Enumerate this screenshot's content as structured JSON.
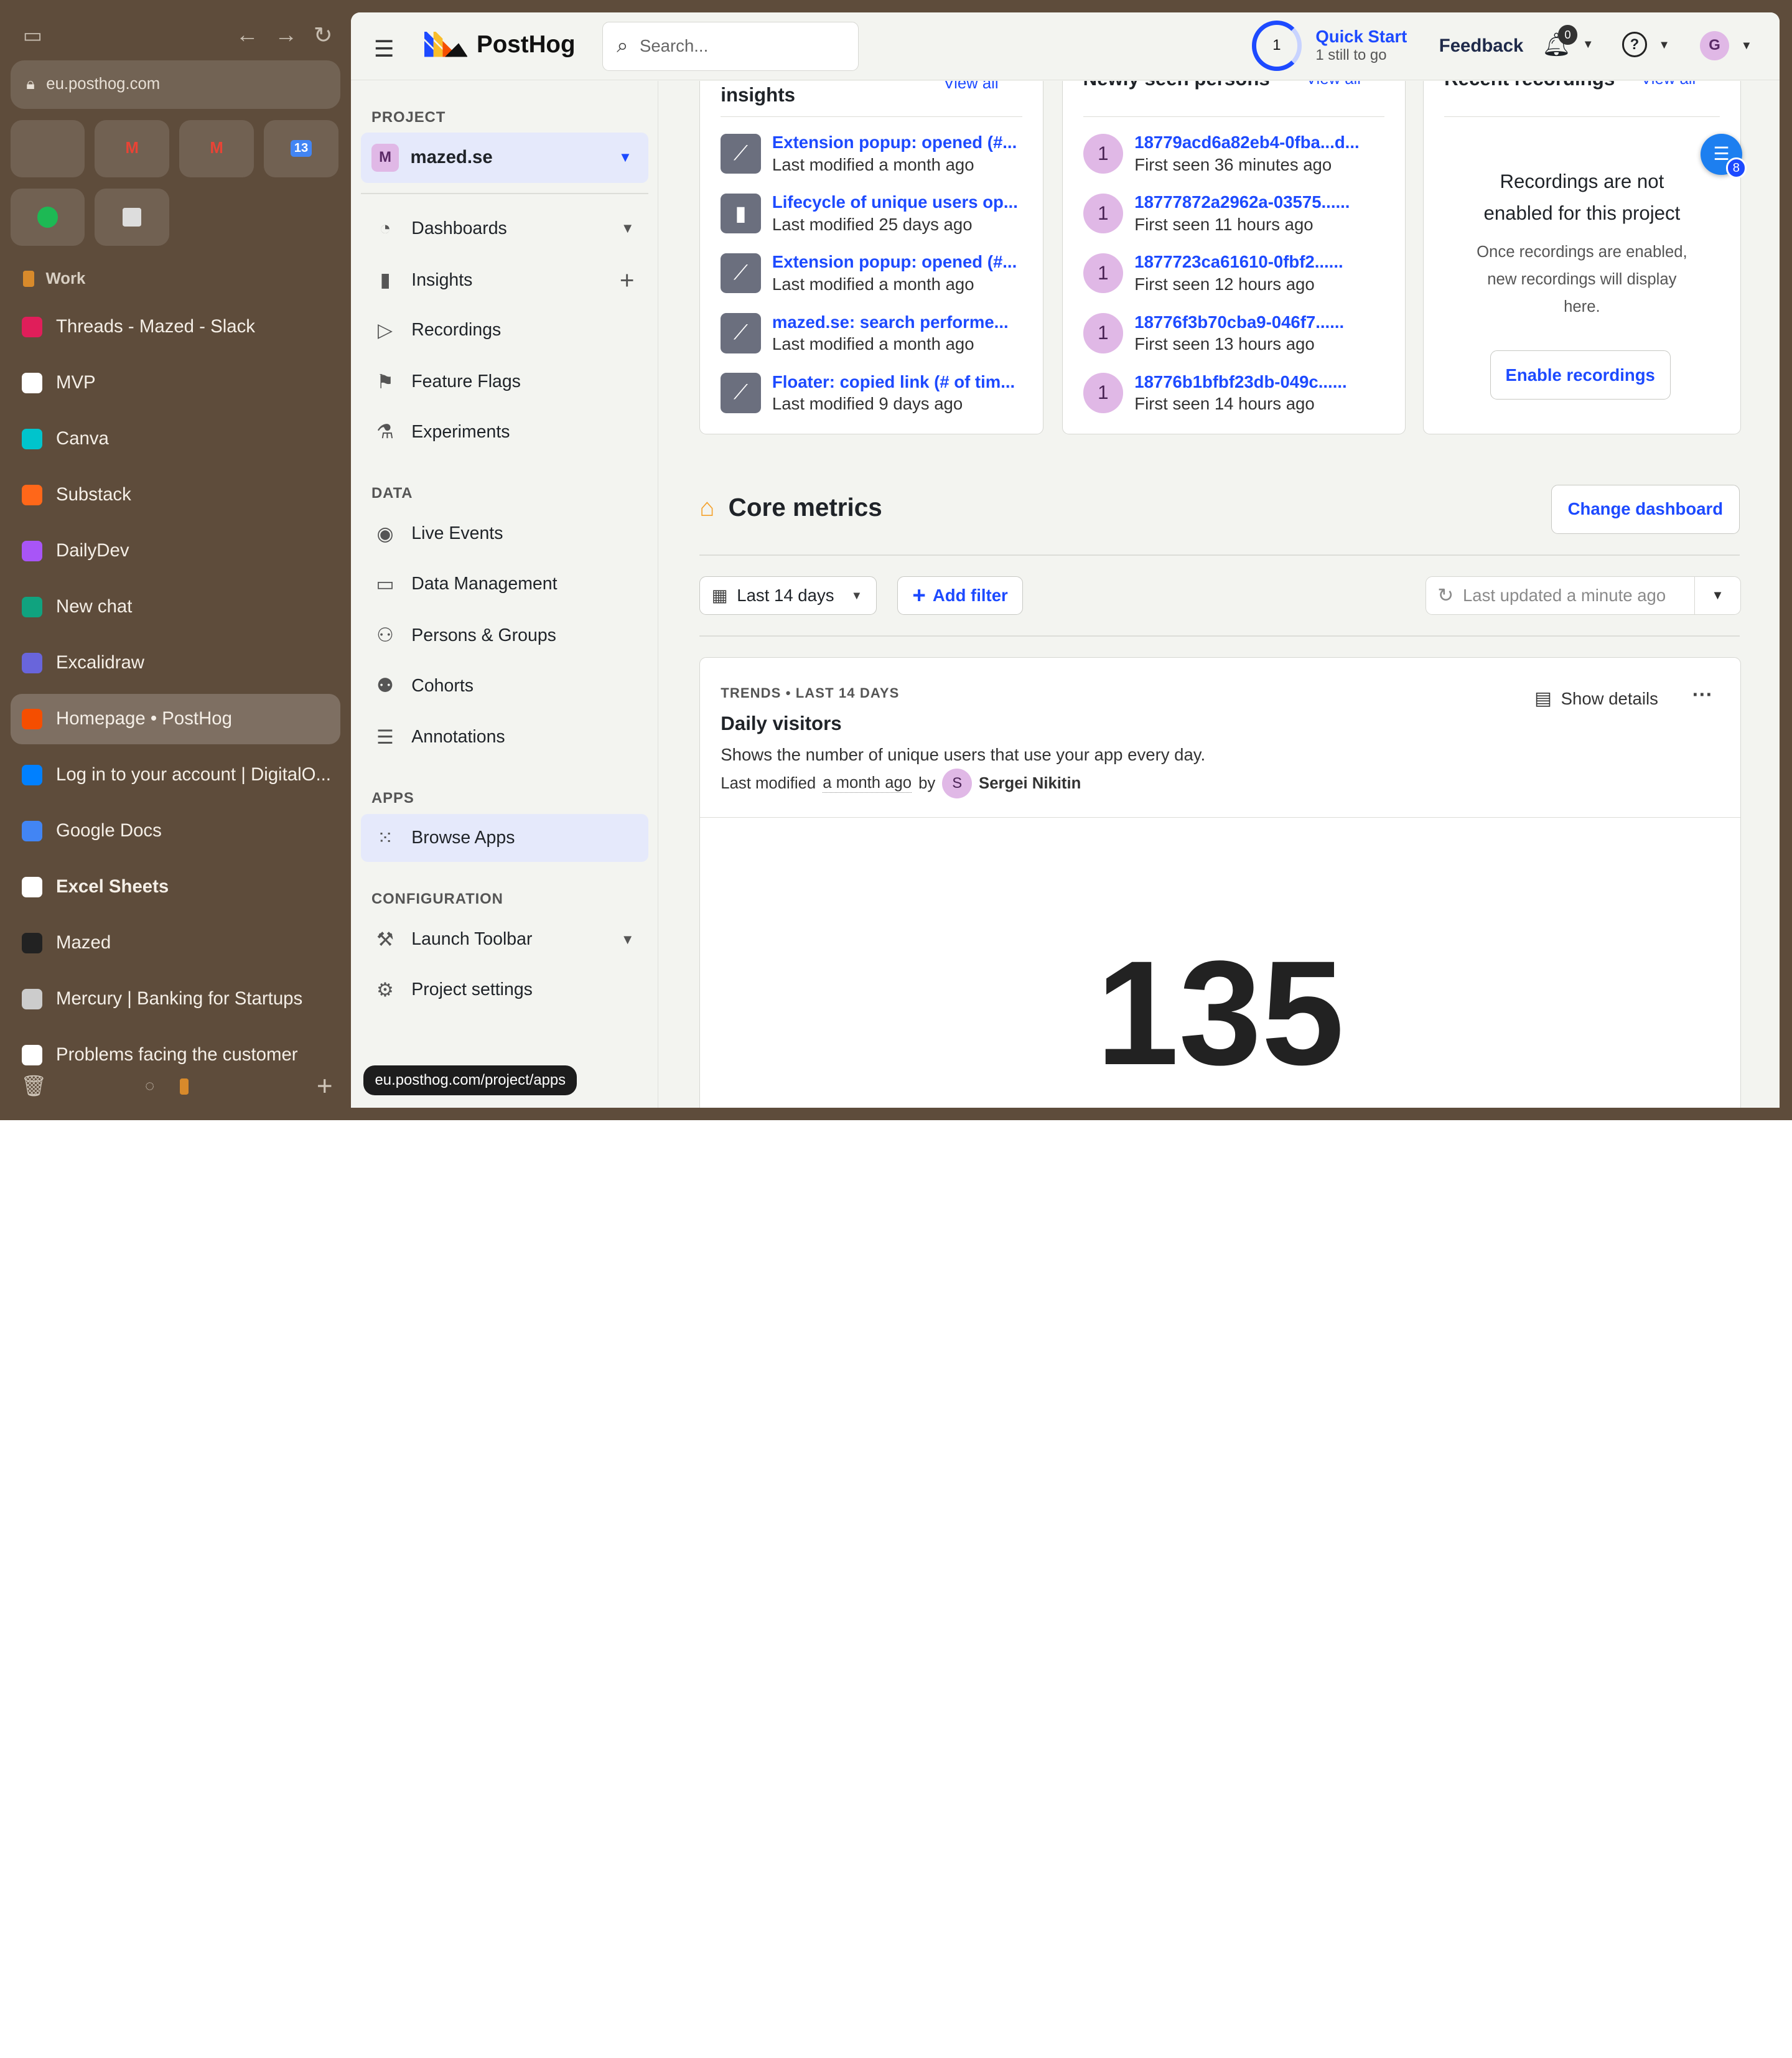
{
  "browser": {
    "url": "eu.posthog.com",
    "space_name": "Work",
    "tabs": [
      {
        "label": "Threads - Mazed - Slack",
        "icon": "slack-icon",
        "color": "#e01e5a"
      },
      {
        "label": "MVP",
        "icon": "github-icon",
        "color": "#ffffff"
      },
      {
        "label": "Canva",
        "icon": "canva-icon",
        "color": "#00c4cc"
      },
      {
        "label": "Substack",
        "icon": "substack-icon",
        "color": "#ff6719"
      },
      {
        "label": "DailyDev",
        "icon": "dailydev-icon",
        "color": "#a855f7"
      },
      {
        "label": "New chat",
        "icon": "openai-icon",
        "color": "#10a37f"
      },
      {
        "label": "Excalidraw",
        "icon": "excalidraw-icon",
        "color": "#6965db"
      },
      {
        "label": "Homepage • PostHog",
        "icon": "posthog-icon",
        "color": "#f54e00"
      },
      {
        "label": "Log in to your account | DigitalO...",
        "icon": "digitalocean-icon",
        "color": "#0080ff"
      },
      {
        "label": "Google Docs",
        "icon": "google-docs-icon",
        "color": "#4285f4"
      },
      {
        "label": "Excel Sheets",
        "icon": "folder-icon",
        "color": "#ffffff"
      },
      {
        "label": "Mazed",
        "icon": "mazed-icon",
        "color": "#222222"
      },
      {
        "label": "Mercury | Banking for Startups",
        "icon": "mercury-icon",
        "color": "#cccccc"
      },
      {
        "label": "Problems facing the customer",
        "icon": "notion-icon",
        "color": "#ffffff"
      }
    ],
    "status_url": "eu.posthog.com/project/apps"
  },
  "topbar": {
    "brand": "PostHog",
    "search_placeholder": "Search...",
    "quick_start": {
      "count": "1",
      "title": "Quick Start",
      "subtitle": "1 still to go"
    },
    "feedback": "Feedback",
    "notifications": "0",
    "user_initial": "G"
  },
  "nav": {
    "project_section": "PROJECT",
    "project_initial": "M",
    "project_name": "mazed.se",
    "items": [
      "Dashboards",
      "Insights",
      "Recordings",
      "Feature Flags",
      "Experiments"
    ],
    "data_section": "DATA",
    "data_items": [
      "Live Events",
      "Data Management",
      "Persons & Groups",
      "Cohorts",
      "Annotations"
    ],
    "apps_section": "APPS",
    "apps_items": [
      "Browse Apps"
    ],
    "config_section": "CONFIGURATION",
    "config_items": [
      "Launch Toolbar",
      "Project settings"
    ]
  },
  "insights_card": {
    "title": "insights",
    "view_all": "View all",
    "rows": [
      {
        "name": "Extension popup: opened (#...",
        "sub": "Last modified a month ago",
        "icon": "trend-icon"
      },
      {
        "name": "Lifecycle of unique users op...",
        "sub": "Last modified 25 days ago",
        "icon": "lifecycle-icon"
      },
      {
        "name": "Extension popup: opened (#...",
        "sub": "Last modified a month ago",
        "icon": "trend-icon"
      },
      {
        "name": "mazed.se: search performe...",
        "sub": "Last modified a month ago",
        "icon": "trend-icon"
      },
      {
        "name": "Floater: copied link (# of tim...",
        "sub": "Last modified 9 days ago",
        "icon": "trend-icon"
      }
    ]
  },
  "persons_card": {
    "title": "Newly seen persons",
    "view_all": "View all",
    "rows": [
      {
        "avatar": "1",
        "id": "18779acd6a82eb4-0fba...d...",
        "sub": "First seen 36 minutes ago"
      },
      {
        "avatar": "1",
        "id": "18777872a2962a-03575......",
        "sub": "First seen 11 hours ago"
      },
      {
        "avatar": "1",
        "id": "1877723ca61610-0fbf2......",
        "sub": "First seen 12 hours ago"
      },
      {
        "avatar": "1",
        "id": "18776f3b70cba9-046f7......",
        "sub": "First seen 13 hours ago"
      },
      {
        "avatar": "1",
        "id": "18776b1bfbf23db-049c......",
        "sub": "First seen 14 hours ago"
      }
    ]
  },
  "recordings_card": {
    "title": "Recent recordings",
    "view_all": "View all",
    "heading_line1": "Recordings are not",
    "heading_line2": "enabled for this project",
    "body_line1": "Once recordings are enabled,",
    "body_line2": "new recordings will display",
    "body_line3": "here.",
    "button": "Enable recordings"
  },
  "floater_badge": "8",
  "core": {
    "title": "Core metrics",
    "change_dashboard": "Change dashboard",
    "date_range": "Last 14 days",
    "add_filter": "Add filter",
    "last_updated": "Last updated a minute ago"
  },
  "trend": {
    "kicker": "TRENDS • LAST 14 DAYS",
    "name": "Daily visitors",
    "description": "Shows the number of unique users that use your app every day.",
    "modified_prefix": "Last modified",
    "modified_when": "a month ago",
    "modified_by": "by",
    "author_initial": "S",
    "author": "Sergei Nikitin",
    "show_details": "Show details",
    "value": "135"
  }
}
